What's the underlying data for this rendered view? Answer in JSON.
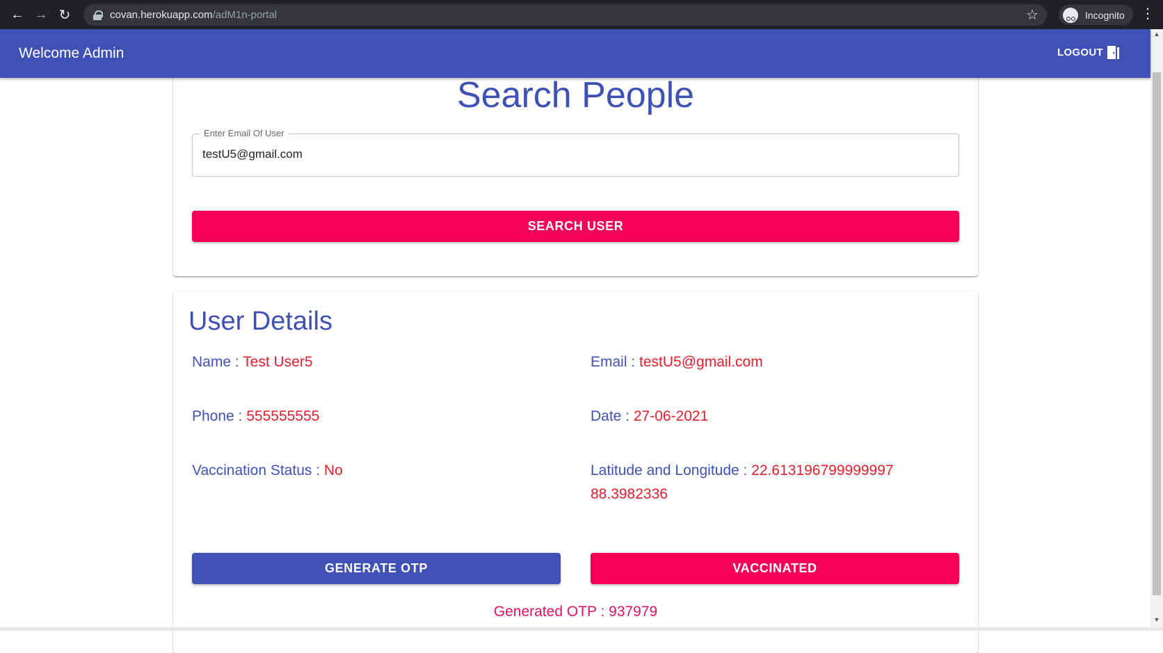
{
  "browser": {
    "url_host": "covan.herokuapp.com",
    "url_path": "/adM1n-portal",
    "profile_label": "Incognito"
  },
  "app_bar": {
    "title": "Welcome Admin",
    "logout_label": "LOGOUT"
  },
  "search": {
    "title": "Search People",
    "email_label": "Enter Email Of User",
    "email_value": "testU5@gmail.com",
    "button_label": "SEARCH USER"
  },
  "details": {
    "title": "User Details",
    "name_label": "Name : ",
    "name_value": "Test User5",
    "email_label": "Email : ",
    "email_value": "testU5@gmail.com",
    "phone_label": "Phone : ",
    "phone_value": "555555555",
    "date_label": "Date : ",
    "date_value": "27-06-2021",
    "vacc_label": "Vaccination Status : ",
    "vacc_value": "No",
    "latlng_label": "Latitude and Longitude : ",
    "latlng_value": "22.613196799999997 88.3982336",
    "generate_otp_label": "GENERATE OTP",
    "vaccinated_label": "VACCINATED",
    "otp_label": "Generated OTP : ",
    "otp_value": "937979"
  },
  "colors": {
    "primary": "#3f51b5",
    "secondary": "#f50057",
    "value_red": "#e41e2b"
  }
}
